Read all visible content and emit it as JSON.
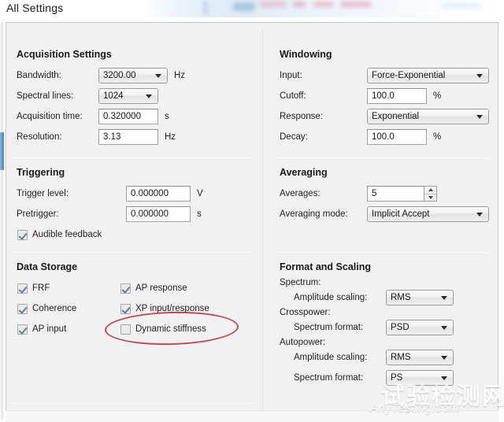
{
  "window": {
    "title": "All Settings"
  },
  "sections": {
    "acquisition": {
      "title": "Acquisition Settings",
      "fields": [
        {
          "label": "Bandwidth:",
          "value": "3200.00",
          "unit": "Hz",
          "control": "combo"
        },
        {
          "label": "Spectral lines:",
          "value": "1024",
          "unit": "",
          "control": "combo"
        },
        {
          "label": "Acquisition time:",
          "value": "0.320000",
          "unit": "s",
          "control": "text"
        },
        {
          "label": "Resolution:",
          "value": "3.13",
          "unit": "Hz",
          "control": "text"
        }
      ]
    },
    "triggering": {
      "title": "Triggering",
      "fields": [
        {
          "label": "Trigger level:",
          "value": "0.000000",
          "unit": "V",
          "control": "text"
        },
        {
          "label": "Pretrigger:",
          "value": "0.000000",
          "unit": "s",
          "control": "text"
        }
      ],
      "checkboxes": [
        {
          "label": "Audible feedback",
          "checked": true
        }
      ]
    },
    "data_storage": {
      "title": "Data Storage",
      "checkboxes_left": [
        {
          "label": "FRF",
          "checked": true
        },
        {
          "label": "Coherence",
          "checked": true
        },
        {
          "label": "AP input",
          "checked": true
        }
      ],
      "checkboxes_right": [
        {
          "label": "AP response",
          "checked": true
        },
        {
          "label": "XP input/response",
          "checked": true
        },
        {
          "label": "Dynamic stiffness",
          "checked": false
        }
      ]
    },
    "windowing": {
      "title": "Windowing",
      "fields": [
        {
          "label": "Input:",
          "value": "Force-Exponential",
          "unit": "",
          "control": "combo"
        },
        {
          "label": "Cutoff:",
          "value": "100.0",
          "unit": "%",
          "control": "text"
        },
        {
          "label": "Response:",
          "value": "Exponential",
          "unit": "",
          "control": "combo"
        },
        {
          "label": "Decay:",
          "value": "100.0",
          "unit": "%",
          "control": "text"
        }
      ]
    },
    "averaging": {
      "title": "Averaging",
      "fields": [
        {
          "label": "Averages:",
          "value": "5",
          "unit": "",
          "control": "spinner"
        },
        {
          "label": "Averaging mode:",
          "value": "Implicit Accept",
          "unit": "",
          "control": "combo"
        }
      ]
    },
    "format_scaling": {
      "title": "Format and Scaling",
      "groups": [
        {
          "heading": "Spectrum:",
          "fields": [
            {
              "label": "Amplitude scaling:",
              "value": "RMS",
              "control": "combo"
            }
          ]
        },
        {
          "heading": "Crosspower:",
          "fields": [
            {
              "label": "Spectrum format:",
              "value": "PSD",
              "control": "combo"
            }
          ]
        },
        {
          "heading": "Autopower:",
          "fields": [
            {
              "label": "Amplitude scaling:",
              "value": "RMS",
              "control": "combo"
            },
            {
              "label": "Spectrum format:",
              "value": "PS",
              "control": "combo"
            }
          ]
        }
      ]
    }
  },
  "annotation": {
    "shape": "red-ellipse",
    "target_label": "Dynamic stiffness",
    "color": "#b32d3c"
  },
  "watermark": {
    "chinese": "试验检测网",
    "english": "AnyTesting.com"
  },
  "colors": {
    "panel_background": "#f1f1f1",
    "text": "#1f1f1f",
    "control_border": "#9a9a9a",
    "checkmark": "#5a7ea8",
    "accent_blue": "#4a7fb5",
    "annotation_red": "#b32d3c"
  }
}
